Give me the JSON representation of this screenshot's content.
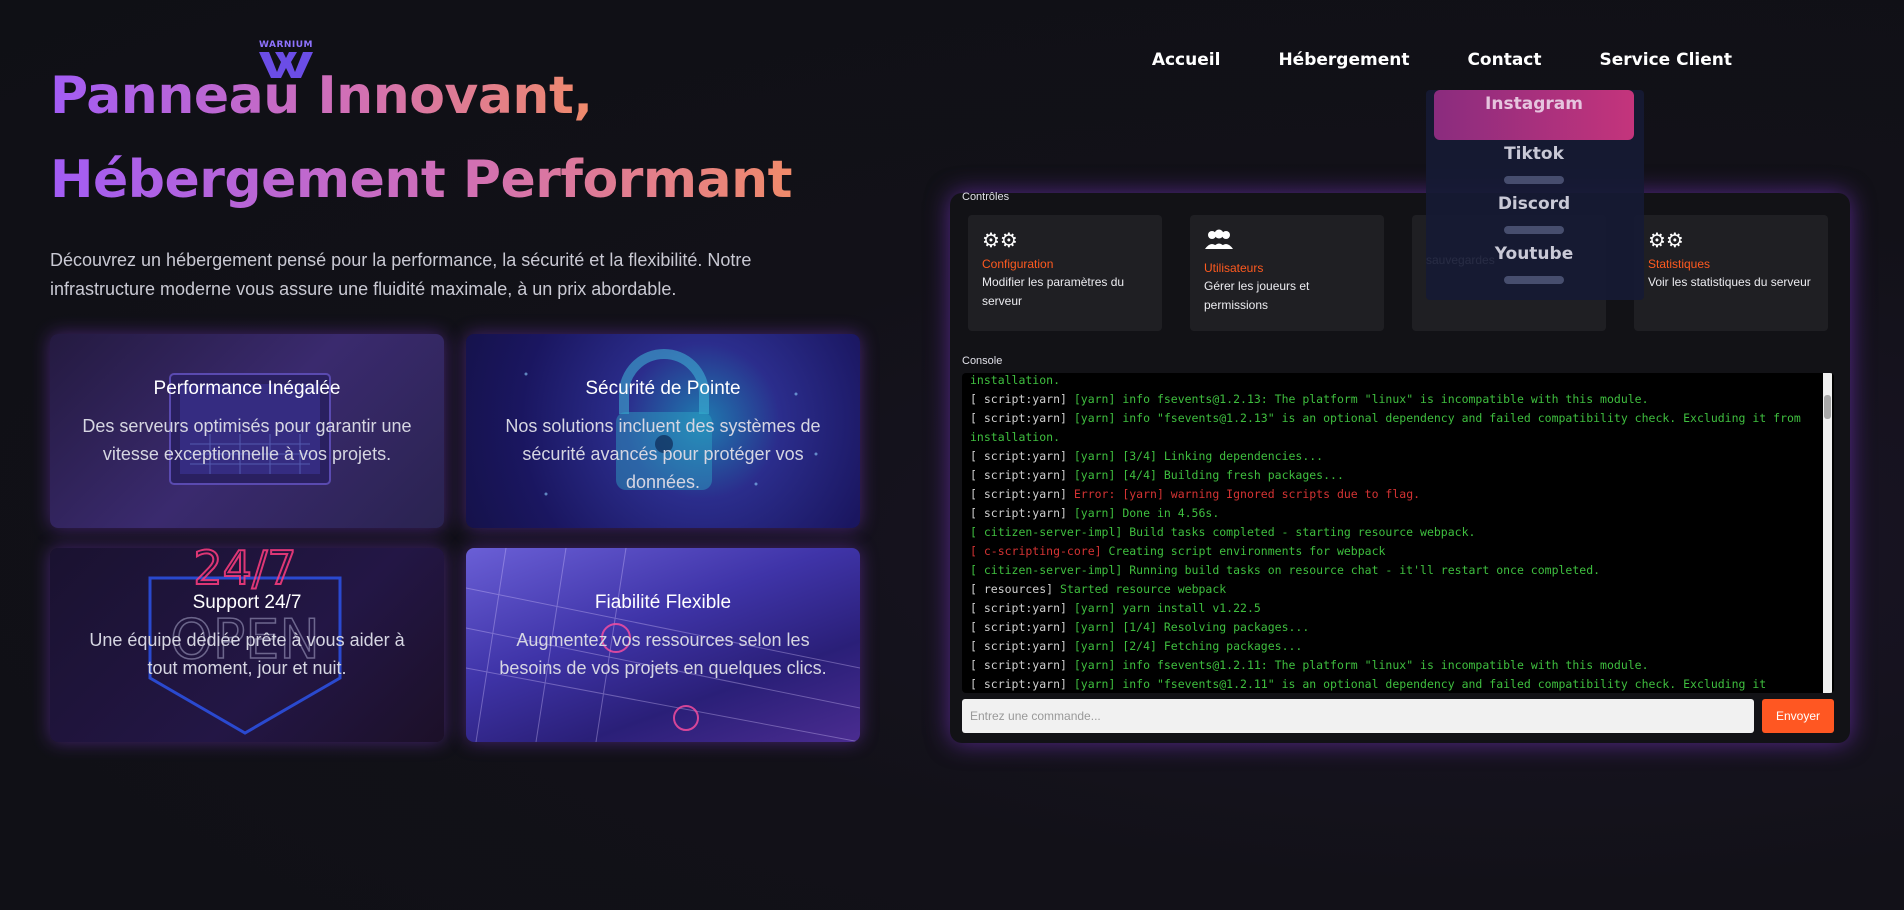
{
  "brand": {
    "logo_text": "WARNIUM"
  },
  "nav": [
    "Accueil",
    "Hébergement",
    "Contact",
    "Service Client"
  ],
  "social_menu": [
    "Instagram",
    "Tiktok",
    "Discord",
    "Youtube"
  ],
  "hero": {
    "title_line1": "Panneau Innovant,",
    "title_line2": "Hébergement Performant",
    "description_line1": "Découvrez un hébergement pensé pour la performance, la sécurité et la flexibilité. Notre",
    "description_line2": "infrastructure moderne vous assure une fluidité maximale, à un prix abordable."
  },
  "features": [
    {
      "title": "Performance Inégalée",
      "desc": "Des serveurs optimisés pour garantir une vitesse exceptionnelle à vos projets."
    },
    {
      "title": "Sécurité de Pointe",
      "desc": "Nos solutions incluent des systèmes de sécurité avancés pour protéger vos données."
    },
    {
      "title": "Support 24/7",
      "desc": "Une équipe dédiée prête à vous aider à tout moment, jour et nuit.",
      "bg_text": "24/7",
      "bg_sign": "OPEN"
    },
    {
      "title": "Fiabilité Flexible",
      "desc": "Augmentez vos ressources selon les besoins de vos projets en quelques clics."
    }
  ],
  "panel": {
    "controls_label": "Contrôles",
    "controls": [
      {
        "icon": "gears-icon",
        "title": "Configuration",
        "desc_line1": "Modifier les paramètres du",
        "desc_line2": "serveur"
      },
      {
        "icon": "users-icon",
        "title": "Utilisateurs",
        "desc_line1": "Gérer les joueurs et",
        "desc_line2": "permissions"
      },
      {
        "icon": "backup-icon",
        "title": "",
        "desc_line1": "",
        "desc_line2": "sauvegardes"
      },
      {
        "icon": "gears-icon",
        "title": "Statistiques",
        "desc_line1": "Voir les statistiques du serveur",
        "desc_line2": ""
      }
    ],
    "console_label": "Console",
    "console_lines": [
      [
        [
          "installation.",
          "g"
        ]
      ],
      [
        [
          "[ script:yarn] ",
          "w"
        ],
        [
          "[yarn] info fsevents@1.2.13: The platform \"linux\" is incompatible with this module.",
          "g"
        ]
      ],
      [
        [
          "[ script:yarn] ",
          "w"
        ],
        [
          "[yarn] info \"fsevents@1.2.13\" is an optional dependency and failed compatibility check. Excluding it from",
          "g"
        ]
      ],
      [
        [
          "installation.",
          "g"
        ]
      ],
      [
        [
          "[ script:yarn] ",
          "w"
        ],
        [
          "[yarn] [3/4] Linking dependencies...",
          "g"
        ]
      ],
      [
        [
          "[ script:yarn] ",
          "w"
        ],
        [
          "[yarn] [4/4] Building fresh packages...",
          "g"
        ]
      ],
      [
        [
          "[ script:yarn] ",
          "w"
        ],
        [
          "Error: [yarn] warning Ignored scripts due to flag.",
          "r"
        ]
      ],
      [
        [
          "[ script:yarn] ",
          "w"
        ],
        [
          "[yarn] Done in 4.56s.",
          "g"
        ]
      ],
      [
        [
          "[ citizen-server-impl] Build tasks completed - starting resource webpack.",
          "g"
        ]
      ],
      [
        [
          "[ c-scripting-core] ",
          "r"
        ],
        [
          "Creating script environments for webpack",
          "g"
        ]
      ],
      [
        [
          "[ citizen-server-impl] Running build tasks on resource chat - it'll restart once completed.",
          "g"
        ]
      ],
      [
        [
          "[ resources] ",
          "w"
        ],
        [
          "Started resource webpack",
          "g"
        ]
      ],
      [
        [
          "[ script:yarn] ",
          "w"
        ],
        [
          "[yarn] yarn install v1.22.5",
          "g"
        ]
      ],
      [
        [
          "[ script:yarn] ",
          "w"
        ],
        [
          "[yarn] [1/4] Resolving packages...",
          "g"
        ]
      ],
      [
        [
          "[ script:yarn] ",
          "w"
        ],
        [
          "[yarn] [2/4] Fetching packages...",
          "g"
        ]
      ],
      [
        [
          "[ script:yarn] ",
          "w"
        ],
        [
          "[yarn] info fsevents@1.2.11: The platform \"linux\" is incompatible with this module.",
          "g"
        ]
      ],
      [
        [
          "[ script:yarn] ",
          "w"
        ],
        [
          "[yarn] info \"fsevents@1.2.11\" is an optional dependency and failed compatibility check. Excluding it",
          "g"
        ]
      ]
    ],
    "command_placeholder": "Entrez une commande...",
    "send_label": "Envoyer"
  },
  "colors": {
    "accent": "#ff5722",
    "title_gradient": [
      "#a25cf5",
      "#d16fb6",
      "#f08a6a"
    ]
  }
}
